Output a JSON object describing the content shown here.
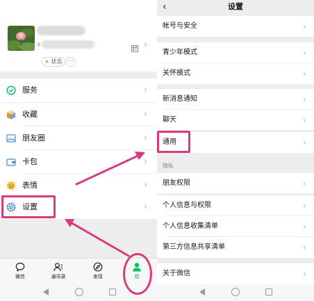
{
  "left": {
    "profile": {
      "status_label": "+ 状态",
      "more_label": "···"
    },
    "menu": [
      {
        "key": "services",
        "label": "服务",
        "icon": "services-icon"
      },
      {
        "key": "favorites",
        "label": "收藏",
        "icon": "favorites-icon"
      },
      {
        "key": "moments",
        "label": "朋友圈",
        "icon": "moments-icon"
      },
      {
        "key": "cards",
        "label": "卡包",
        "icon": "card-wallet-icon"
      },
      {
        "key": "stickers",
        "label": "表情",
        "icon": "sticker-icon"
      },
      {
        "key": "settings",
        "label": "设置",
        "icon": "gear-icon"
      }
    ],
    "tabbar": [
      {
        "key": "chats",
        "label": "微信",
        "icon": "chat-bubble-icon",
        "active": false
      },
      {
        "key": "contacts",
        "label": "通讯录",
        "icon": "contacts-icon",
        "active": false
      },
      {
        "key": "discover",
        "label": "发现",
        "icon": "compass-icon",
        "active": false
      },
      {
        "key": "me",
        "label": "我",
        "icon": "person-icon",
        "active": true
      }
    ]
  },
  "right": {
    "header": {
      "back_icon": "chevron-left-icon",
      "title": "设置"
    },
    "rows": [
      {
        "key": "account-security",
        "label": "帐号与安全"
      },
      {
        "key": "teen-mode",
        "label": "青少年模式"
      },
      {
        "key": "care-mode",
        "label": "关怀模式"
      },
      {
        "key": "new-message-notify",
        "label": "新消息通知"
      },
      {
        "key": "chat",
        "label": "聊天"
      },
      {
        "key": "general",
        "label": "通用"
      },
      {
        "key": "friend-permissions",
        "label": "朋友权限"
      },
      {
        "key": "personal-info",
        "label": "个人信息与权限"
      },
      {
        "key": "info-collection",
        "label": "个人信息收集清单"
      },
      {
        "key": "third-party-sharing",
        "label": "第三方信息共享清单"
      },
      {
        "key": "about",
        "label": "关于微信"
      }
    ],
    "section_privacy": "隐私"
  },
  "colors": {
    "accent_green": "#07c160",
    "highlight": "#d83a80",
    "background": "#ededed"
  }
}
